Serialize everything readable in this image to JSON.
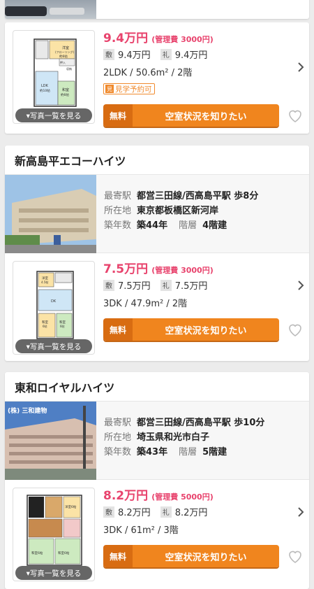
{
  "colors": {
    "price": "#e8436d",
    "cta": "#f0851e",
    "cta_dark": "#d86c12"
  },
  "first_card": {
    "price": "9.4万円",
    "mgmt": "(管理費 3000円)",
    "deposit_tag": "敷",
    "deposit": "9.4万円",
    "key_tag": "礼",
    "key": "9.4万円",
    "layout": "2LDK /  50.6m² /  2階",
    "tour_icon": "見",
    "tour": "見学予約可",
    "photo_btn": "▾写真一覧を見る",
    "cta_free": "無料",
    "cta_main": "空室状況を知りたい",
    "fp_labels": {
      "r1": "洋室",
      "r1s": "(フローリング)",
      "r1t": "約6帖",
      "ldk": "LDK",
      "ldk2": "約10帖",
      "r2": "和室",
      "r2t": "約6帖",
      "c": "押入",
      "s": "収納"
    }
  },
  "buildings": [
    {
      "name": "新高島平エコーハイツ",
      "station_label": "最寄駅",
      "station": "都営三田線/西高島平駅 歩8分",
      "address_label": "所在地",
      "address": "東京都板橋区新河岸",
      "age_label": "築年数",
      "age": "築44年",
      "floor_label": "階層",
      "floors": "4階建",
      "unit": {
        "price": "7.5万円",
        "mgmt": "(管理費 3000円)",
        "deposit_tag": "敷",
        "deposit": "7.5万円",
        "key_tag": "礼",
        "key": "7.5万円",
        "layout": "3DK /  47.9m² /  2階",
        "photo_btn": "▾写真一覧を見る",
        "cta_free": "無料",
        "cta_main": "空室状況を知りたい",
        "fp_labels": {
          "r1": "洋室",
          "r1t": "4.5帖",
          "dk": "DK",
          "r2": "和室",
          "r2t": "6帖",
          "r3": "和室",
          "r3t": "6帖"
        }
      }
    },
    {
      "name": "東和ロイヤルハイツ",
      "photo_caption": "(株) 三和建物",
      "station_label": "最寄駅",
      "station": "都営三田線/西高島平駅 歩10分",
      "address_label": "所在地",
      "address": "埼玉県和光市白子",
      "age_label": "築年数",
      "age": "築43年",
      "floor_label": "階層",
      "floors": "5階建",
      "unit": {
        "price": "8.2万円",
        "mgmt": "(管理費 5000円)",
        "deposit_tag": "敷",
        "deposit": "8.2万円",
        "key_tag": "礼",
        "key": "8.2万円",
        "layout": "3DK /  61m² /  3階",
        "photo_btn": "▾写真一覧を見る",
        "cta_free": "無料",
        "cta_main": "空室状況を知りたい",
        "fp_labels": {
          "r1": "洋室6帖",
          "r2": "和室6帖",
          "r3": "和室6帖"
        }
      }
    }
  ]
}
